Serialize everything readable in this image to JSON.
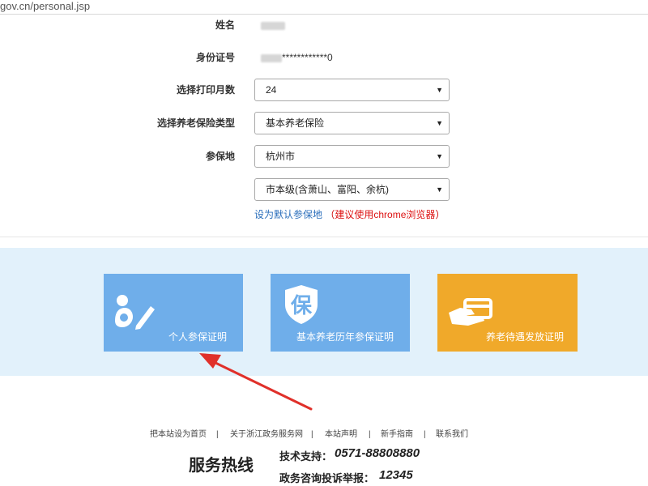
{
  "browser": {
    "url": "gov.cn/personal.jsp"
  },
  "form": {
    "name_label": "姓名",
    "id_label": "身份证号",
    "id_value_tail": "************0",
    "months_label": "选择打印月数",
    "months_value": "24",
    "type_label": "选择养老保险类型",
    "type_value": "基本养老保险",
    "location_label": "参保地",
    "city_value": "杭州市",
    "district_value": "市本级(含萧山、富阳、余杭)",
    "set_default_link": "设为默认参保地",
    "hint_open": "（",
    "hint_text": "建议使用chrome浏览器",
    "hint_close": "）"
  },
  "cards": [
    {
      "label": "个人参保证明",
      "icon": "person-pen-icon",
      "color": "#6faeea"
    },
    {
      "label": "基本养老历年参保证明",
      "icon": "shield-bao-icon",
      "color": "#6faeea"
    },
    {
      "label": "养老待遇发放证明",
      "icon": "hand-card-icon",
      "color": "#f0a92a"
    }
  ],
  "shield_char": "保",
  "footer": {
    "links": [
      "把本站设为首页",
      "关于浙江政务服务网",
      "本站声明",
      "新手指南",
      "联系我们"
    ],
    "separator": "|",
    "hotline_title": "服务热线",
    "support_label": "技术支持：",
    "support_number": "0571-88808880",
    "complaint_label": "政务咨询投诉举报：",
    "complaint_number": "12345"
  },
  "colors": {
    "link": "#2a6ebb",
    "warning": "#d11111",
    "band": "#e2f1fb",
    "arrow": "#e0302a"
  }
}
